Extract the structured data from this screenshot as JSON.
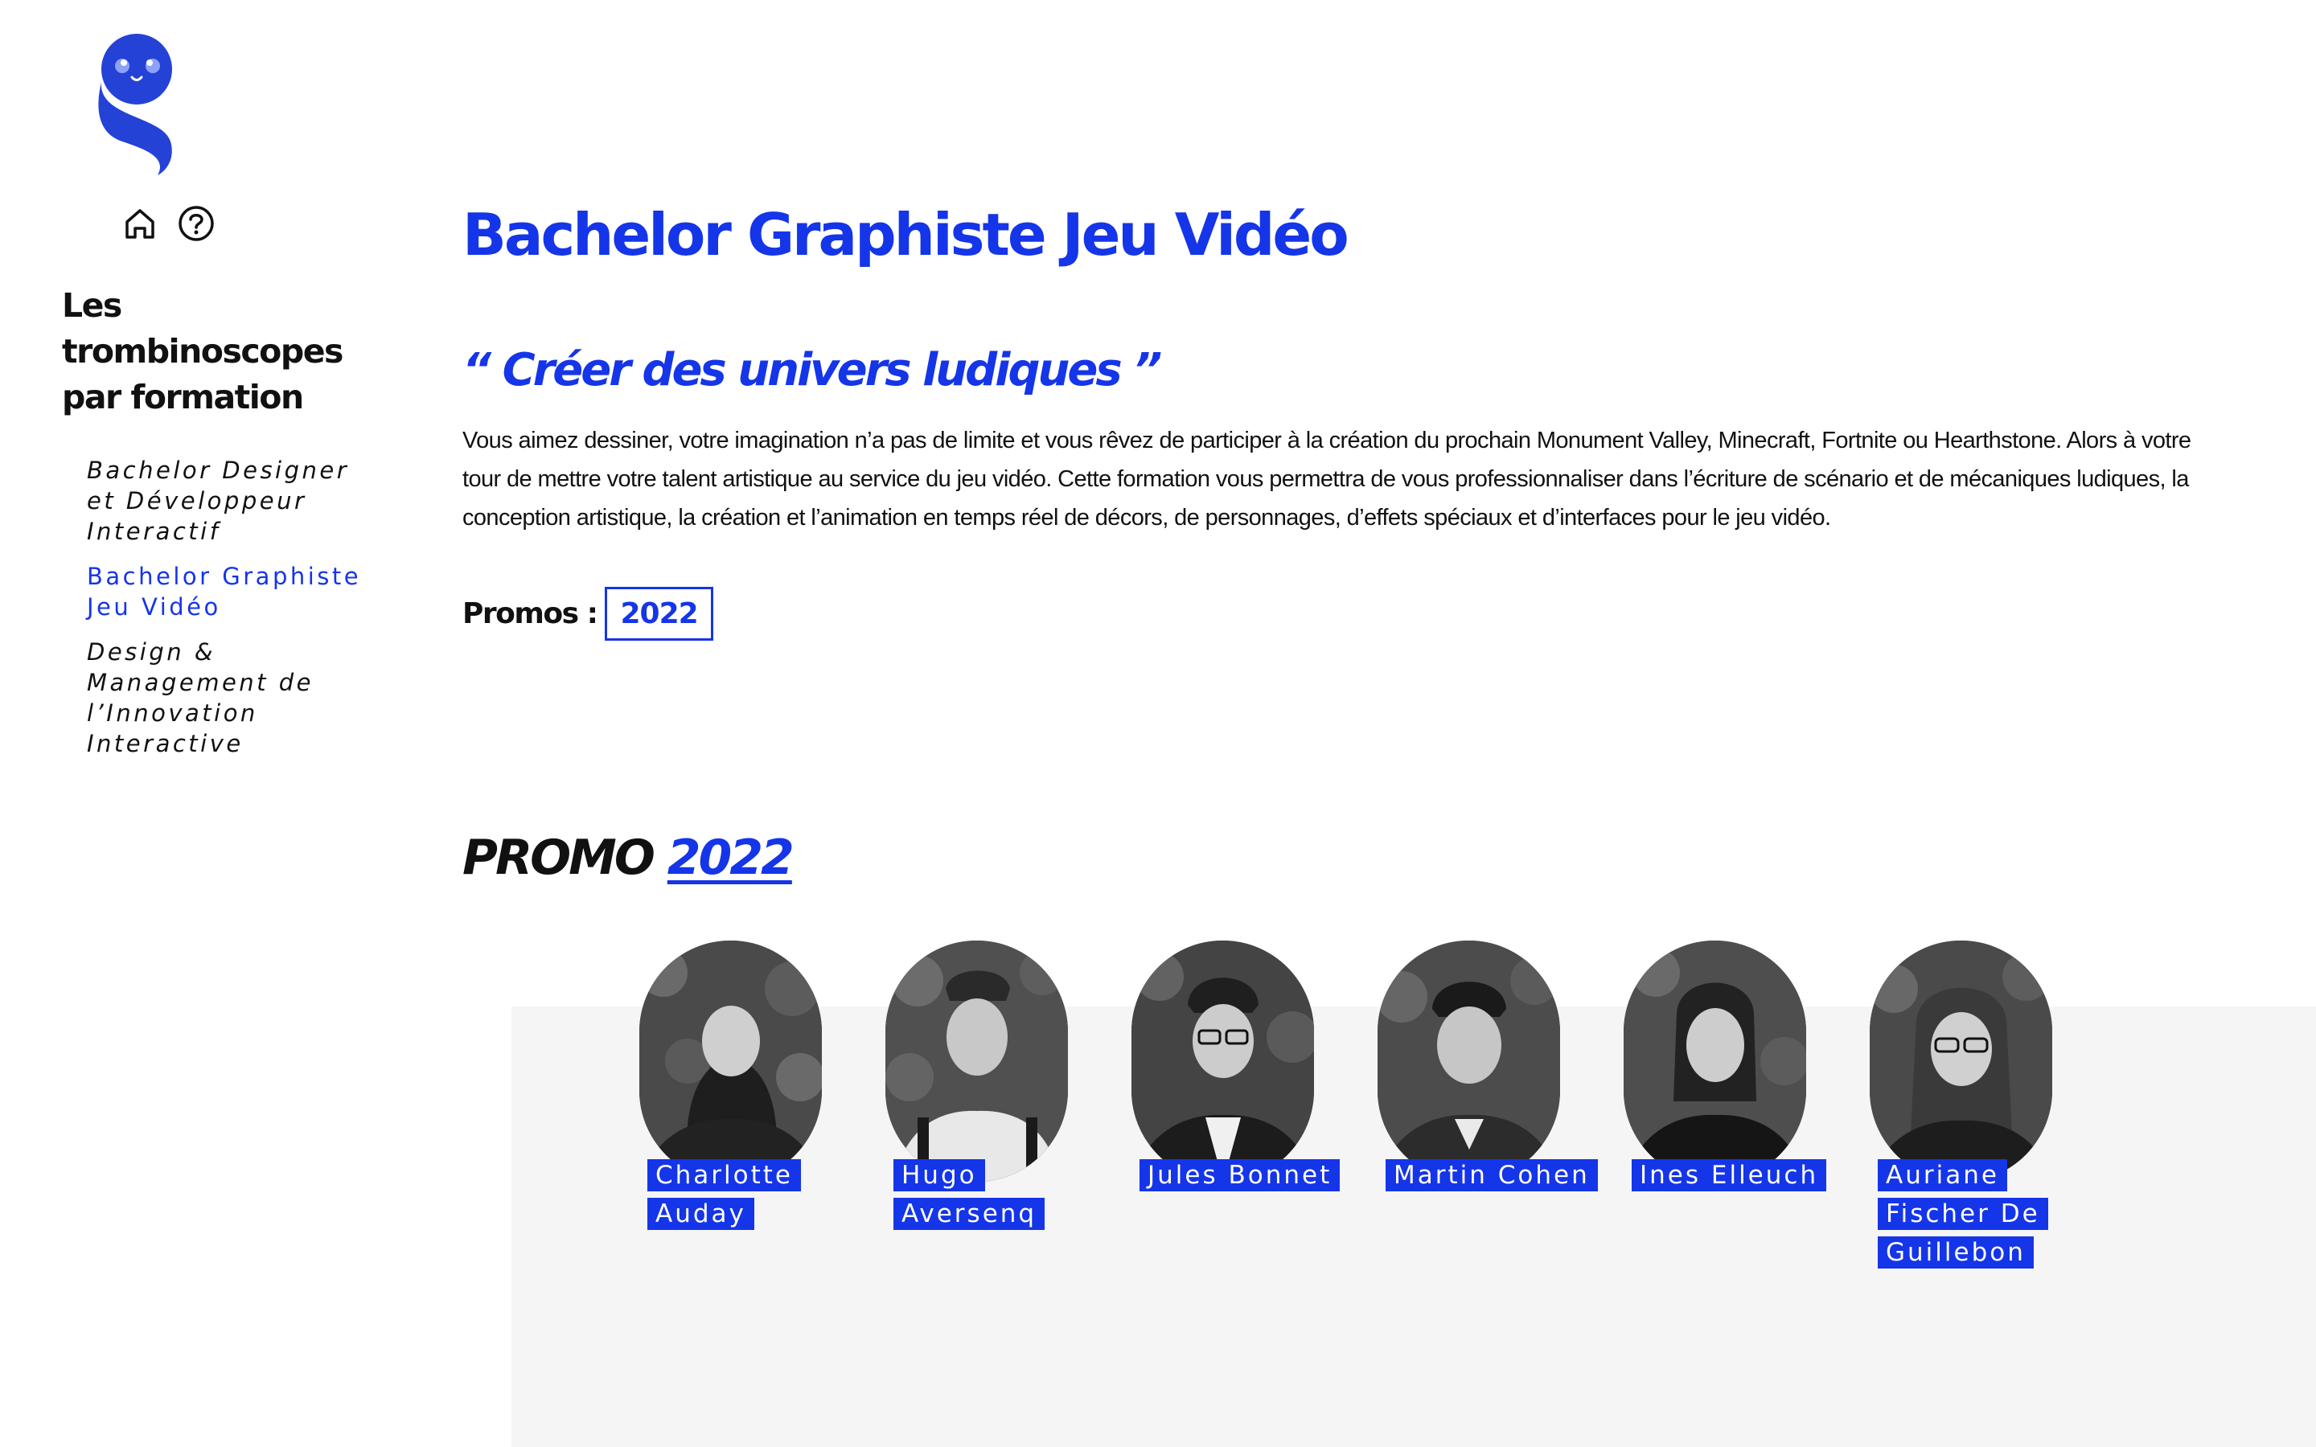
{
  "brand": {
    "logo_icon": "ghost-mascot-icon",
    "color": "#1535e8"
  },
  "toolbar": {
    "home_icon": "home-icon",
    "help_icon": "help-circle-icon"
  },
  "sidebar": {
    "title": "Les trombinoscopes par formation",
    "items": [
      {
        "label": "Bachelor Designer et Développeur Interactif",
        "active": false
      },
      {
        "label": "Bachelor Graphiste Jeu Vidéo",
        "active": true
      },
      {
        "label": "Design & Management de l’Innovation Interactive",
        "active": false
      }
    ]
  },
  "main": {
    "title": "Bachelor Graphiste Jeu Vidéo",
    "quote": "“ Créer des univers ludiques ”",
    "description": "Vous aimez dessiner, votre imagination n’a pas de limite et vous rêvez de participer à la création du prochain Monument Valley, Minecraft, Fortnite ou Hearthstone. Alors à votre tour de mettre votre talent artistique au service du jeu vidéo. Cette formation vous permettra de vous professionnaliser dans l’écriture de scénario et de mécaniques ludiques, la conception artistique, la création et l’animation en temps réel de décors, de personnages, d’effets spéciaux et d’interfaces pour le jeu vidéo.",
    "promos_label": "Promos :",
    "promos": [
      "2022"
    ]
  },
  "promo_section": {
    "prefix": "PROMO",
    "year": "2022",
    "students": [
      {
        "name_lines": [
          "Charlotte",
          "Auday"
        ]
      },
      {
        "name_lines": [
          "Hugo",
          "Aversenq"
        ]
      },
      {
        "name_lines": [
          "Jules Bonnet"
        ]
      },
      {
        "name_lines": [
          "Martin Cohen"
        ]
      },
      {
        "name_lines": [
          "Ines Elleuch"
        ]
      },
      {
        "name_lines": [
          "Auriane",
          "Fischer De",
          "Guillebon"
        ]
      }
    ]
  }
}
